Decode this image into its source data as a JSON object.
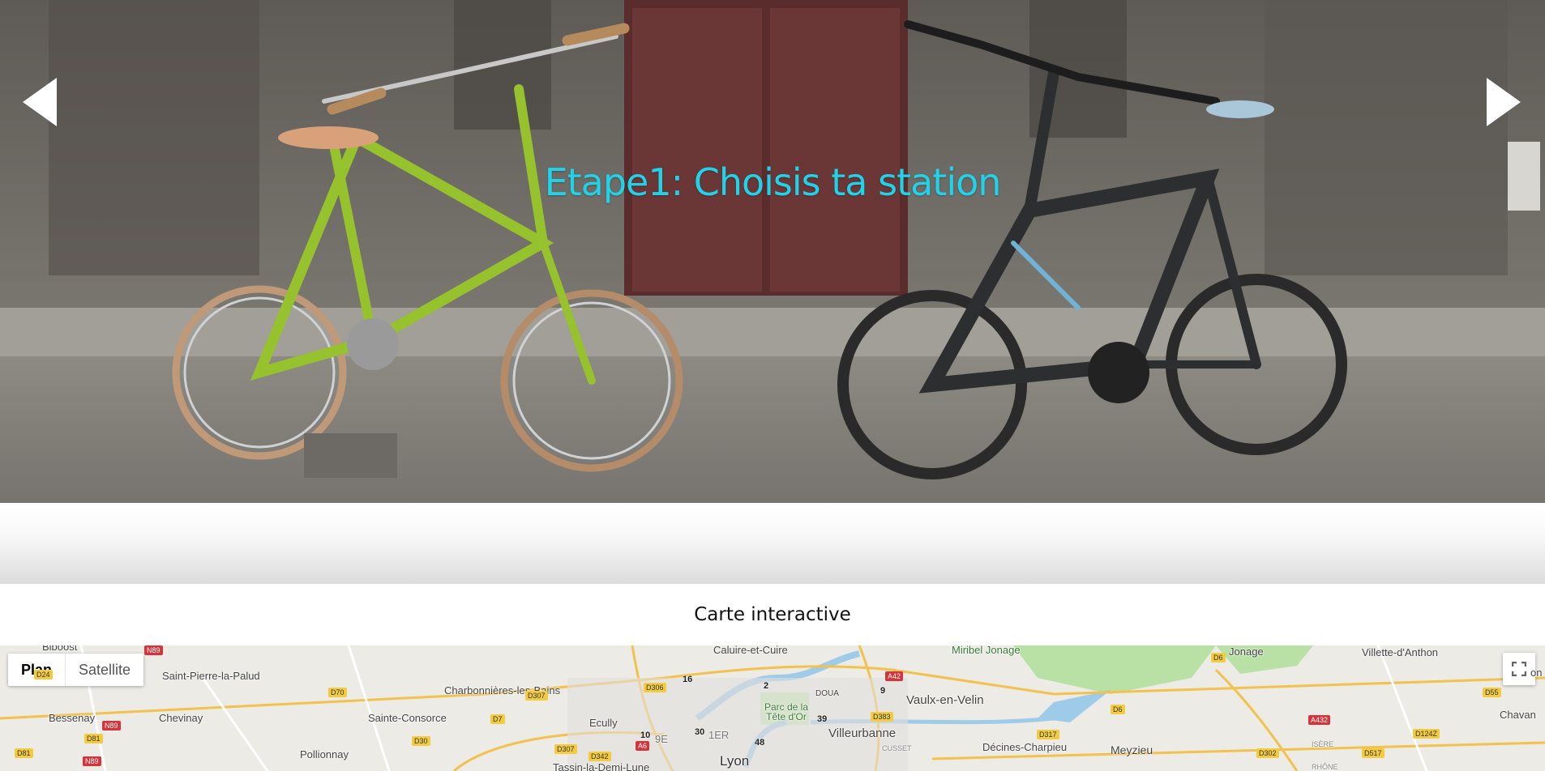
{
  "slider": {
    "title": "Etape1: Choisis ta station",
    "prev_icon": "triangle-left-icon",
    "next_icon": "triangle-right-icon"
  },
  "section": {
    "title": "Carte interactive"
  },
  "map": {
    "type_plan": "Plan",
    "type_satellite": "Satellite",
    "fullscreen_icon": "fullscreen-icon",
    "places": {
      "biboste": "Biboost",
      "caluire": "Caluire-et-Cuire",
      "miribel": "Miribel Jonage",
      "jonage": "Jonage",
      "villette": "Villette-d'Anthon",
      "saint_pierre": "Saint-Pierre-la-Palud",
      "charbonnieres": "Charbonnières-les-Bains",
      "doua": "DOUA",
      "vaulx": "Vaulx-en-Velin",
      "bessenay": "Bessenay",
      "chevinay": "Chevinay",
      "sainte_consorce": "Sainte-Consorce",
      "ecully": "Ecully",
      "parc": "Parc de la Tête d'Or",
      "villeurbanne": "Villeurbanne",
      "chavan": "Chavan",
      "pollionnay": "Pollionnay",
      "neuvieme": "9E",
      "premier": "1ER",
      "cusset": "CUSSET",
      "decines": "Décines-Charpieu",
      "meyzieu": "Meyzieu",
      "isere": "ISÈRE",
      "tassin": "Tassin-la-Demi-Lune",
      "lyon": "Lyon",
      "rhone": "RHÔNE",
      "on_edge": "on"
    },
    "roads": {
      "n89_top": "N89",
      "d24": "D24",
      "d70": "D70",
      "d307": "D307",
      "d306": "D306",
      "a42": "A42",
      "d6_top": "D6",
      "d55": "D55",
      "n89_mid": "N89",
      "d81": "D81",
      "d7": "D7",
      "d383": "D383",
      "d6_mid": "D6",
      "a432": "A432",
      "d30": "D30",
      "d317": "D317",
      "d124z": "D124Z",
      "d81_low": "D81",
      "n89_low": "N89",
      "d307_low": "D307",
      "d342": "D342",
      "a6": "A6",
      "d302": "D302",
      "d517": "D517"
    },
    "stations": [
      "16",
      "2",
      "9",
      "10",
      "30",
      "39",
      "48"
    ]
  }
}
